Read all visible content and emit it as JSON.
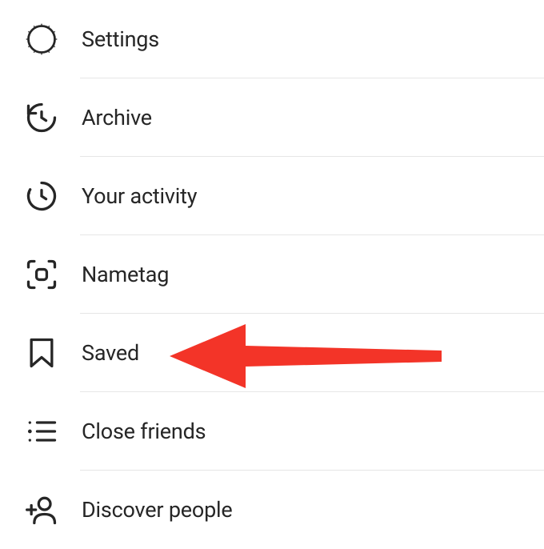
{
  "menu": {
    "items": [
      {
        "label": "Settings"
      },
      {
        "label": "Archive"
      },
      {
        "label": "Your activity"
      },
      {
        "label": "Nametag"
      },
      {
        "label": "Saved"
      },
      {
        "label": "Close friends"
      },
      {
        "label": "Discover people"
      }
    ]
  },
  "annotation": {
    "icon": "arrow-left",
    "color": "#f33428"
  }
}
